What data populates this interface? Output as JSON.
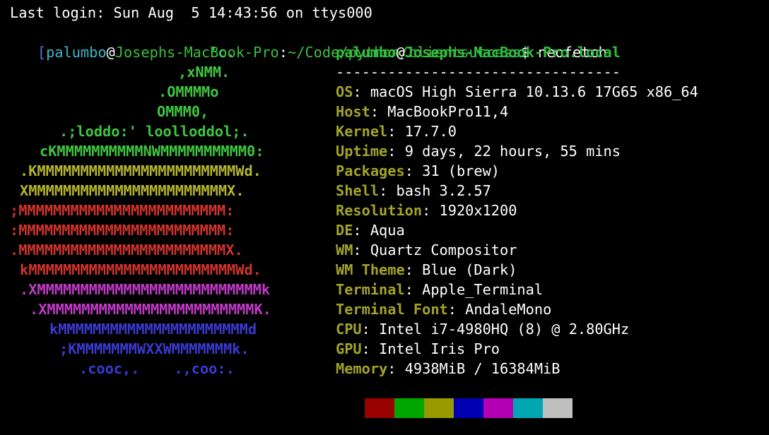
{
  "login_line": "Last login: Sun Aug  5 14:43:56 on ttys000",
  "prompt": {
    "bracket": "[",
    "user": "palumbo",
    "at": "@",
    "host": "Josephs-MacBook-Pro",
    "colon": ":",
    "path": "~/Code/python/clientsuccess",
    "symbol": "$ ",
    "command": "neofetch"
  },
  "logo": [
    {
      "text": "'c.",
      "color": "#3fc63f"
    },
    {
      "text": ",xNMM.",
      "color": "#3fc63f"
    },
    {
      "text": ".OMMMMo",
      "color": "#3fc63f"
    },
    {
      "text": "OMMM0,",
      "color": "#3fc63f"
    },
    {
      "text": ".;loddo:' loolloddol;.",
      "color": "#3fc63f"
    },
    {
      "text": "cKMMMMMMMMMMNWMMMMMMMMMM0:",
      "color": "#3fc63f"
    },
    {
      "text": ".KMMMMMMMMMMMMMMMMMMMMMMMWd.",
      "color": "#b4b42e"
    },
    {
      "text": "XMMMMMMMMMMMMMMMMMMMMMMMX.",
      "color": "#b4b42e"
    },
    {
      "text": ";MMMMMMMMMMMMMMMMMMMMMMMM:",
      "color": "#d0342c"
    },
    {
      "text": ":MMMMMMMMMMMMMMMMMMMMMMMM:",
      "color": "#d0342c"
    },
    {
      "text": ".MMMMMMMMMMMMMMMMMMMMMMMMX.",
      "color": "#d0342c"
    },
    {
      "text": "kMMMMMMMMMMMMMMMMMMMMMMMMWd.",
      "color": "#d0342c"
    },
    {
      "text": ".XMMMMMMMMMMMMMMMMMMMMMMMMMMk",
      "color": "#c23ac8"
    },
    {
      "text": ".XMMMMMMMMMMMMMMMMMMMMMMMMK.",
      "color": "#c23ac8"
    },
    {
      "text": "kMMMMMMMMMMMMMMMMMMMMMMd",
      "color": "#3a3ad2"
    },
    {
      "text": ";KMMMMMMMWXXWMMMMMMMk.",
      "color": "#3a3ad2"
    },
    {
      "text": ".cooc,.    .,coo:.",
      "color": "#3a3ad2"
    }
  ],
  "info": {
    "header_user": "palumbo",
    "header_at": "@",
    "header_host": "Josephs-MacBook-Pro.local",
    "separator": "---------------------------------",
    "rows": [
      {
        "key": "OS",
        "value": "macOS High Sierra 10.13.6 17G65 x86_64"
      },
      {
        "key": "Host",
        "value": "MacBookPro11,4"
      },
      {
        "key": "Kernel",
        "value": "17.7.0"
      },
      {
        "key": "Uptime",
        "value": "9 days, 22 hours, 55 mins"
      },
      {
        "key": "Packages",
        "value": "31 (brew)"
      },
      {
        "key": "Shell",
        "value": "bash 3.2.57"
      },
      {
        "key": "Resolution",
        "value": "1920x1200"
      },
      {
        "key": "DE",
        "value": "Aqua"
      },
      {
        "key": "WM",
        "value": "Quartz Compositor"
      },
      {
        "key": "WM Theme",
        "value": "Blue (Dark)"
      },
      {
        "key": "Terminal",
        "value": "Apple_Terminal"
      },
      {
        "key": "Terminal Font",
        "value": "AndaleMono"
      },
      {
        "key": "CPU",
        "value": "Intel i7-4980HQ (8) @ 2.80GHz"
      },
      {
        "key": "GPU",
        "value": "Intel Iris Pro"
      },
      {
        "key": "Memory",
        "value": "4938MiB / 16384MiB"
      }
    ],
    "key_suffix": ": "
  },
  "palette_colors": [
    "#990000",
    "#00a600",
    "#999900",
    "#0000b2",
    "#b200b2",
    "#00a6b2",
    "#bfbfbf"
  ]
}
